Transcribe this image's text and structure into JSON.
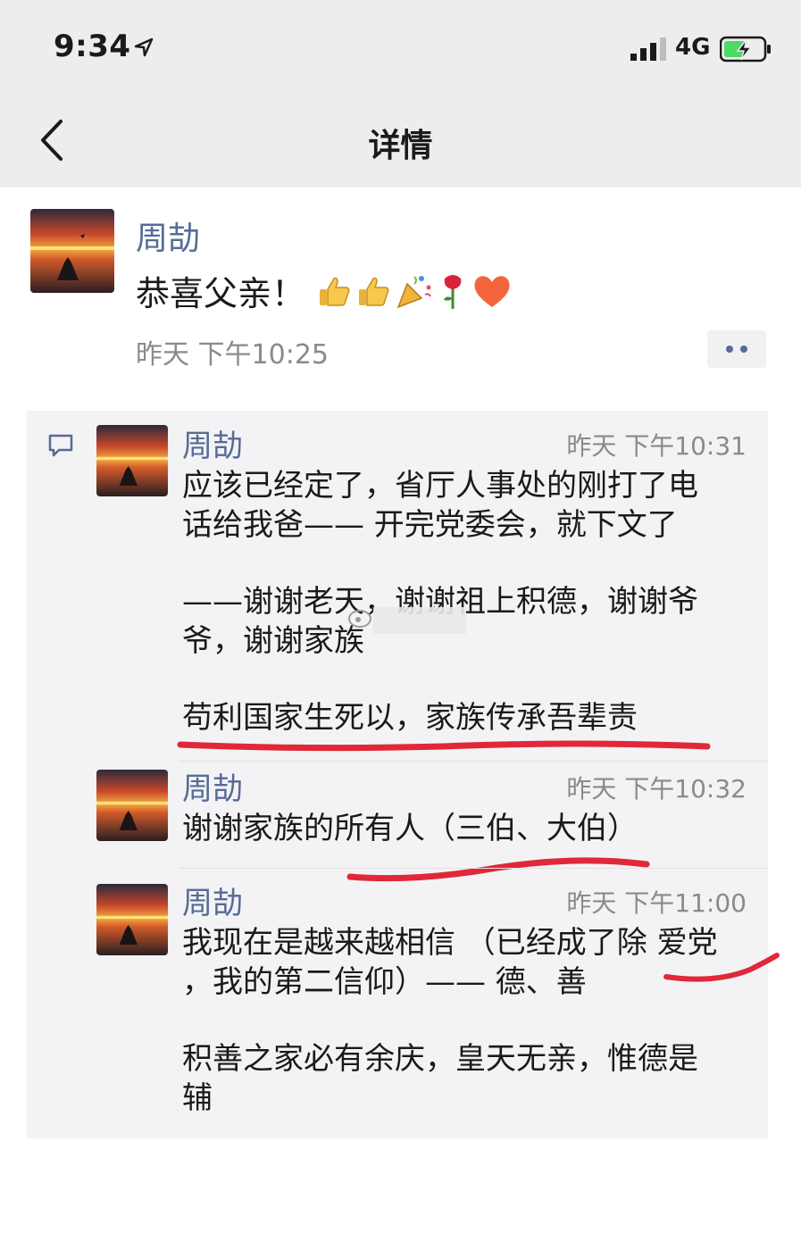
{
  "status": {
    "time": "9:34",
    "network": "4G"
  },
  "nav": {
    "title": "详情"
  },
  "post": {
    "author": "周劼",
    "text": "恭喜父亲！",
    "time": "昨天 下午10:25"
  },
  "comments": [
    {
      "author": "周劼",
      "time": "昨天 下午10:31",
      "lines": [
        "应该已经定了，省厅人事处的刚打了电",
        "话给我爸—— 开完党委会，就下文了",
        "",
        "——谢谢老天，谢谢祖上积德，谢谢爷",
        "爷，谢谢家族",
        "",
        "苟利国家生死以，家族传承吾辈责"
      ]
    },
    {
      "author": "周劼",
      "time": "昨天 下午10:32",
      "lines": [
        "谢谢家族的所有人（三伯、大伯）"
      ]
    },
    {
      "author": "周劼",
      "time": "昨天 下午11:00",
      "lines": [
        "我现在是越来越相信 （已经成了除 爱党",
        "，我的第二信仰）—— 德、善",
        "",
        "积善之家必有余庆，皇天无亲，惟德是",
        "辅"
      ]
    }
  ],
  "colors": {
    "name": "#576b95",
    "annotation": "#e0283a",
    "bar": "#ededed"
  },
  "icons": [
    "location-arrow-icon",
    "signal-icon",
    "battery-charging-icon",
    "back-chevron-icon",
    "thumbs-up-icon",
    "party-popper-icon",
    "rose-icon",
    "heart-icon",
    "comment-icon",
    "more-dots-icon"
  ]
}
